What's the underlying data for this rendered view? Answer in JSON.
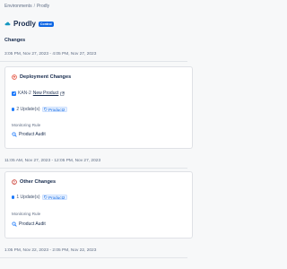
{
  "breadcrumb": {
    "items": [
      "Environments",
      "Prodly"
    ],
    "separator": "/"
  },
  "header": {
    "title": "Prodly",
    "badge": "Control",
    "icon": "cloud-icon"
  },
  "section_heading": "Changes",
  "groups": [
    {
      "time_range": "3:05 PM, Nov 27, 2023 - 4:05 PM, Nov 27, 2023",
      "card": {
        "title": "Deployment Changes",
        "icon": "deployment-icon",
        "issue_key": "KAN-2",
        "issue_link": "New Product",
        "updates": "2 Update(s)",
        "chip": "Product2",
        "rule_label": "Monitoring Rule",
        "rule": "Product Audit"
      }
    },
    {
      "time_range": "11:05 AM, Nov 27, 2023 - 12:05 PM, Nov 27, 2023",
      "card": {
        "title": "Other Changes",
        "icon": "warning-circle-icon",
        "updates": "1 Update(s)",
        "chip": "Product2",
        "rule_label": "Monitoring Rule",
        "rule": "Product Audit"
      }
    },
    {
      "time_range": "1:05 PM, Nov 22, 2023 - 2:05 PM, Nov 22, 2023"
    }
  ],
  "colors": {
    "accent": "#0c66e4",
    "deployment_icon": "#e34935",
    "warning_icon": "#c9372c"
  }
}
